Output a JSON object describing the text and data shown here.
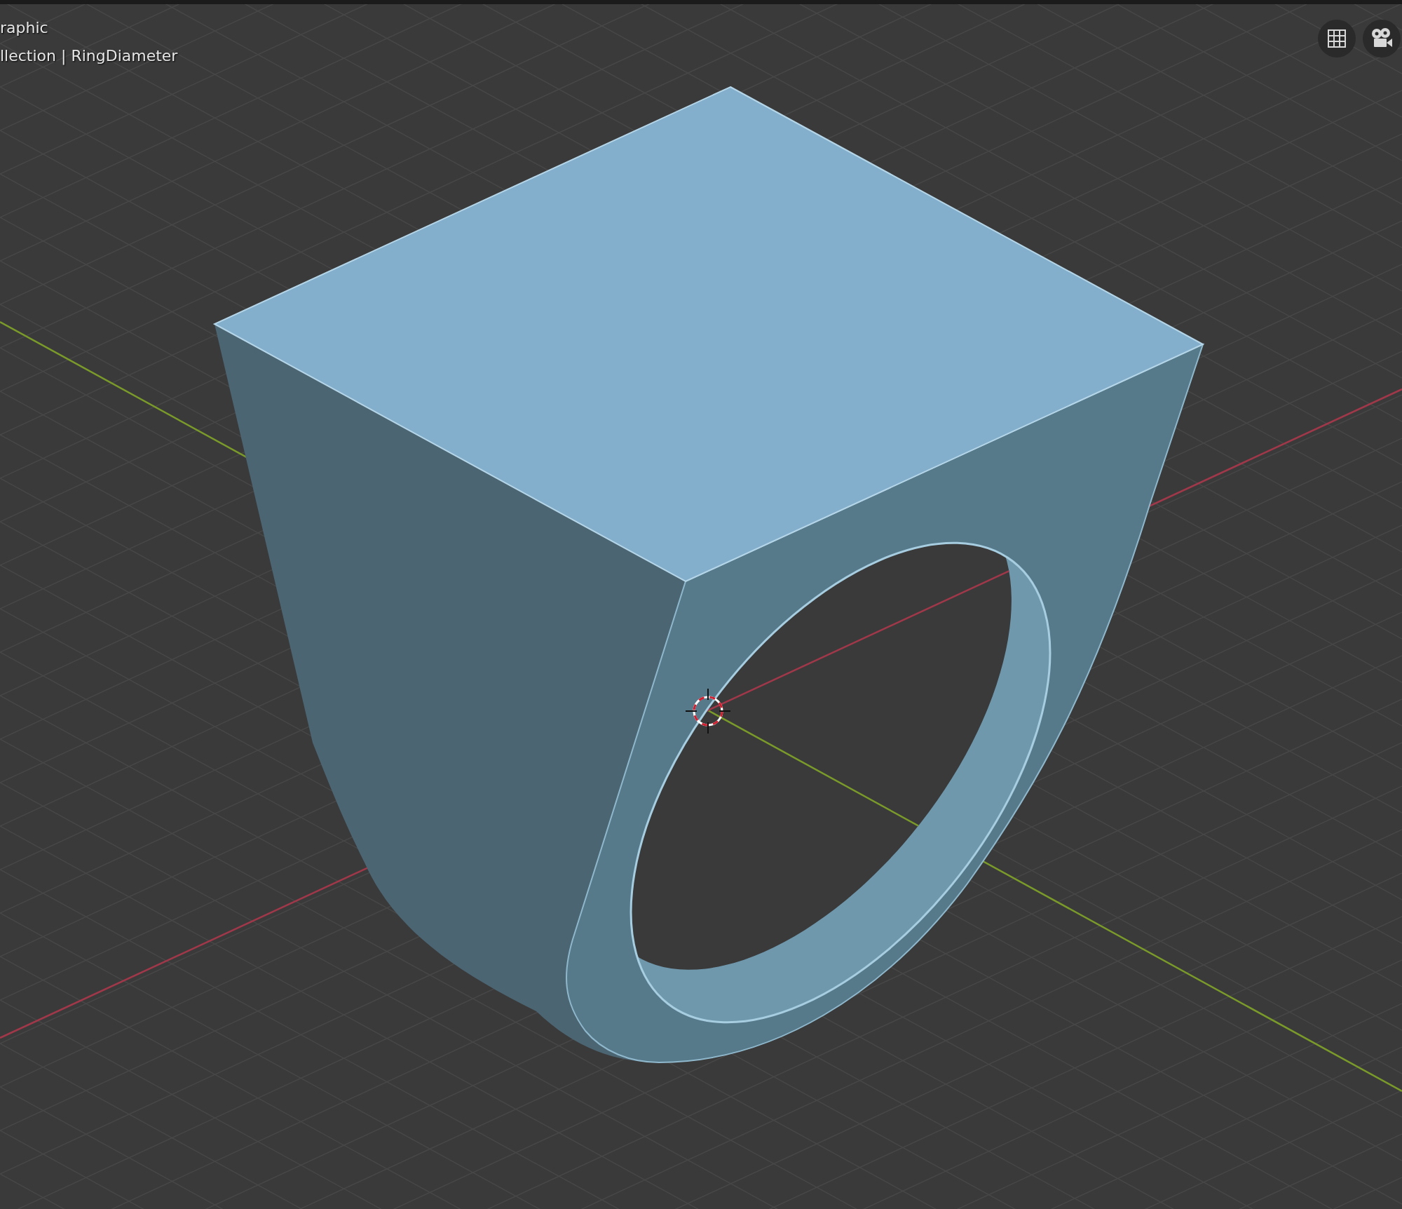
{
  "viewport": {
    "overlay_lines": [
      "raphic",
      "llection | RingDiameter"
    ]
  },
  "header_buttons": [
    {
      "kind": "grid"
    },
    {
      "kind": "camera"
    }
  ]
}
